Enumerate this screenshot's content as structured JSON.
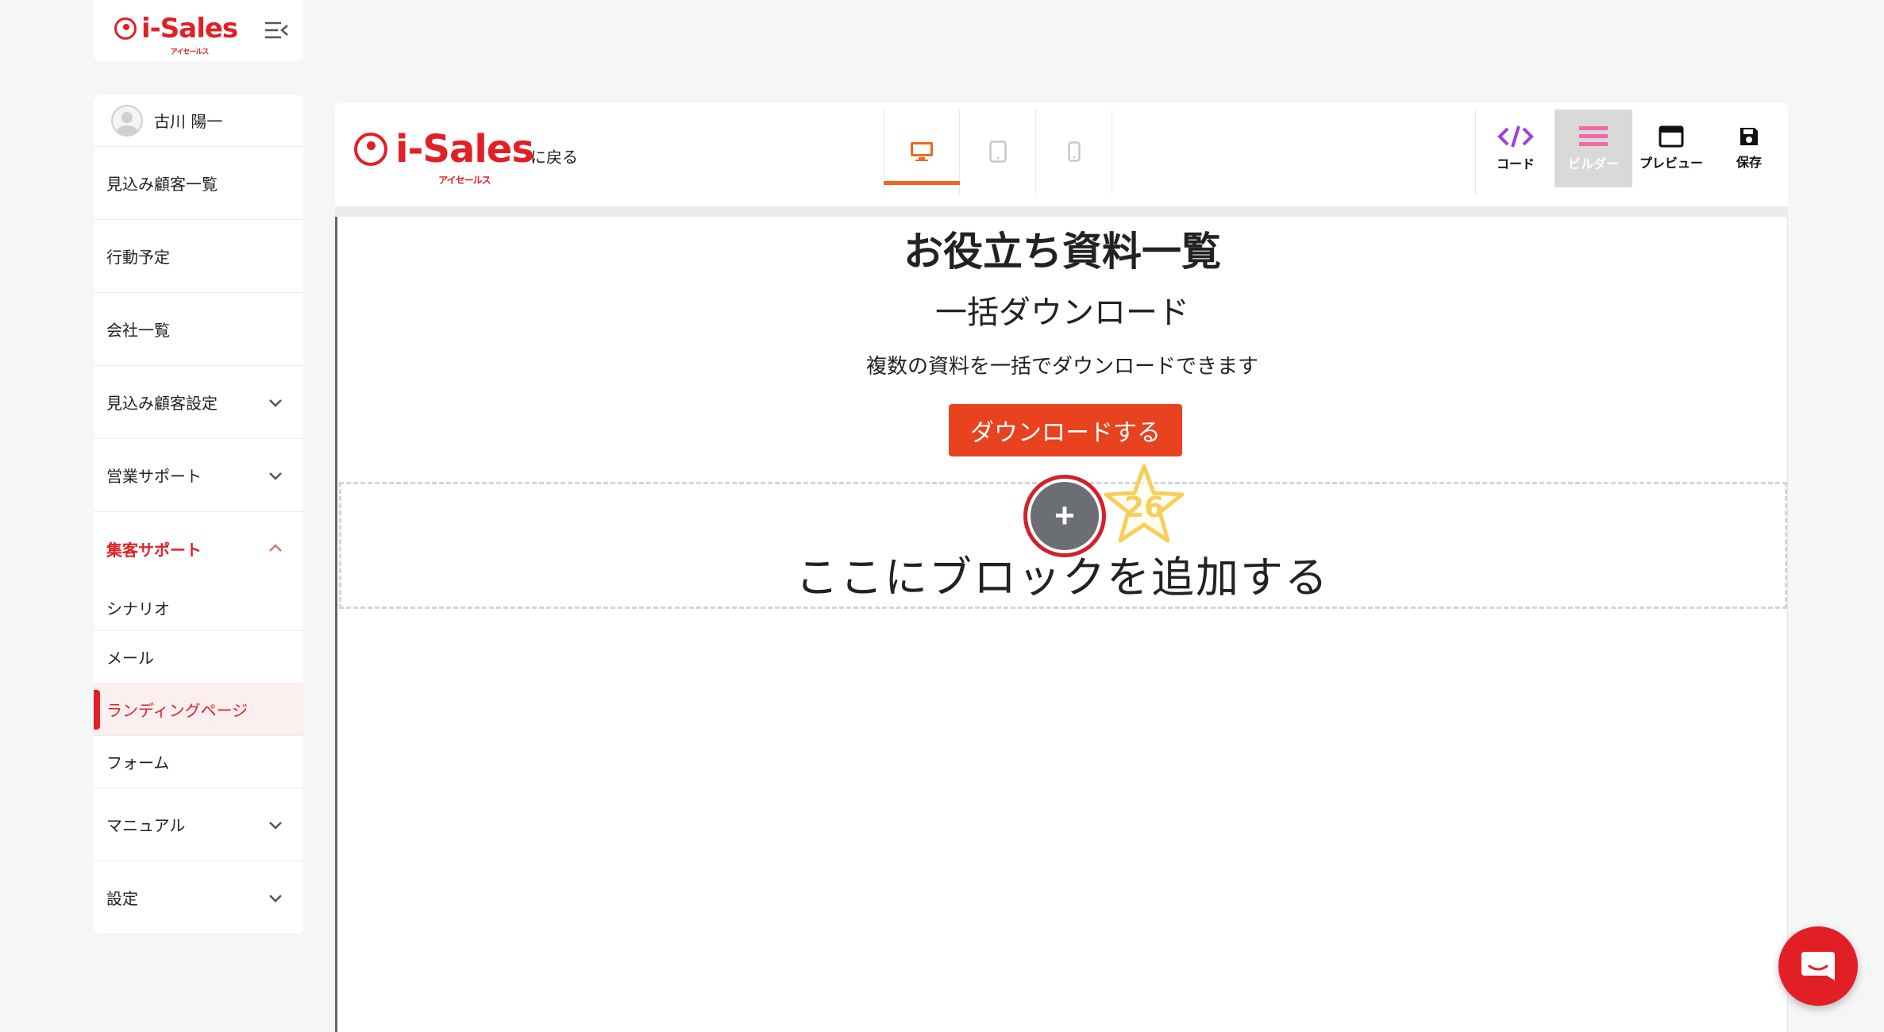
{
  "brand": {
    "name": "i-Sales",
    "sub": "アイセールス"
  },
  "sidebar": {
    "user_name": "古川 陽一",
    "items": [
      {
        "label": "見込み顧客一覧",
        "has_chevron": false
      },
      {
        "label": "行動予定",
        "has_chevron": false
      },
      {
        "label": "会社一覧",
        "has_chevron": false
      },
      {
        "label": "見込み顧客設定",
        "has_chevron": true,
        "chevron": "down"
      },
      {
        "label": "営業サポート",
        "has_chevron": true,
        "chevron": "down"
      },
      {
        "label": "集客サポート",
        "has_chevron": true,
        "chevron": "up",
        "active": true
      }
    ],
    "sub_items": [
      {
        "label": "シナリオ"
      },
      {
        "label": "メール"
      },
      {
        "label": "ランディングページ",
        "current": true
      },
      {
        "label": "フォーム"
      }
    ],
    "bottom_items": [
      {
        "label": "マニュアル",
        "chevron": "down"
      },
      {
        "label": "設定",
        "chevron": "down"
      }
    ]
  },
  "editor": {
    "back_label": "に戻る",
    "device_tabs": [
      {
        "name": "desktop",
        "icon": "monitor-icon",
        "selected": true
      },
      {
        "name": "tablet",
        "icon": "tablet-icon",
        "selected": false
      },
      {
        "name": "mobile",
        "icon": "phone-icon",
        "selected": false
      }
    ],
    "tools": [
      {
        "label": "コード",
        "icon": "code-icon",
        "selected": false
      },
      {
        "label": "ビルダー",
        "icon": "builder-icon",
        "selected": true
      },
      {
        "label": "プレビュー",
        "icon": "preview-icon",
        "selected": false
      },
      {
        "label": "保存",
        "icon": "save-icon",
        "selected": false
      }
    ]
  },
  "canvas": {
    "title": "お役立ち資料一覧",
    "subtitle": "一括ダウンロード",
    "description": "複数の資料を一括でダウンロードできます",
    "button_label": "ダウンロードする",
    "add_block_label": "ここにブロックを追加する",
    "add_button_symbol": "+",
    "step_badge": "26"
  },
  "colors": {
    "brand_red": "#e31f26",
    "download_button": "#e8421f",
    "device_underline": "#f0671e",
    "code_icon": "#a23ee0",
    "builder_icon": "#ee6aa7",
    "badge_star": "#f6cf5a"
  }
}
